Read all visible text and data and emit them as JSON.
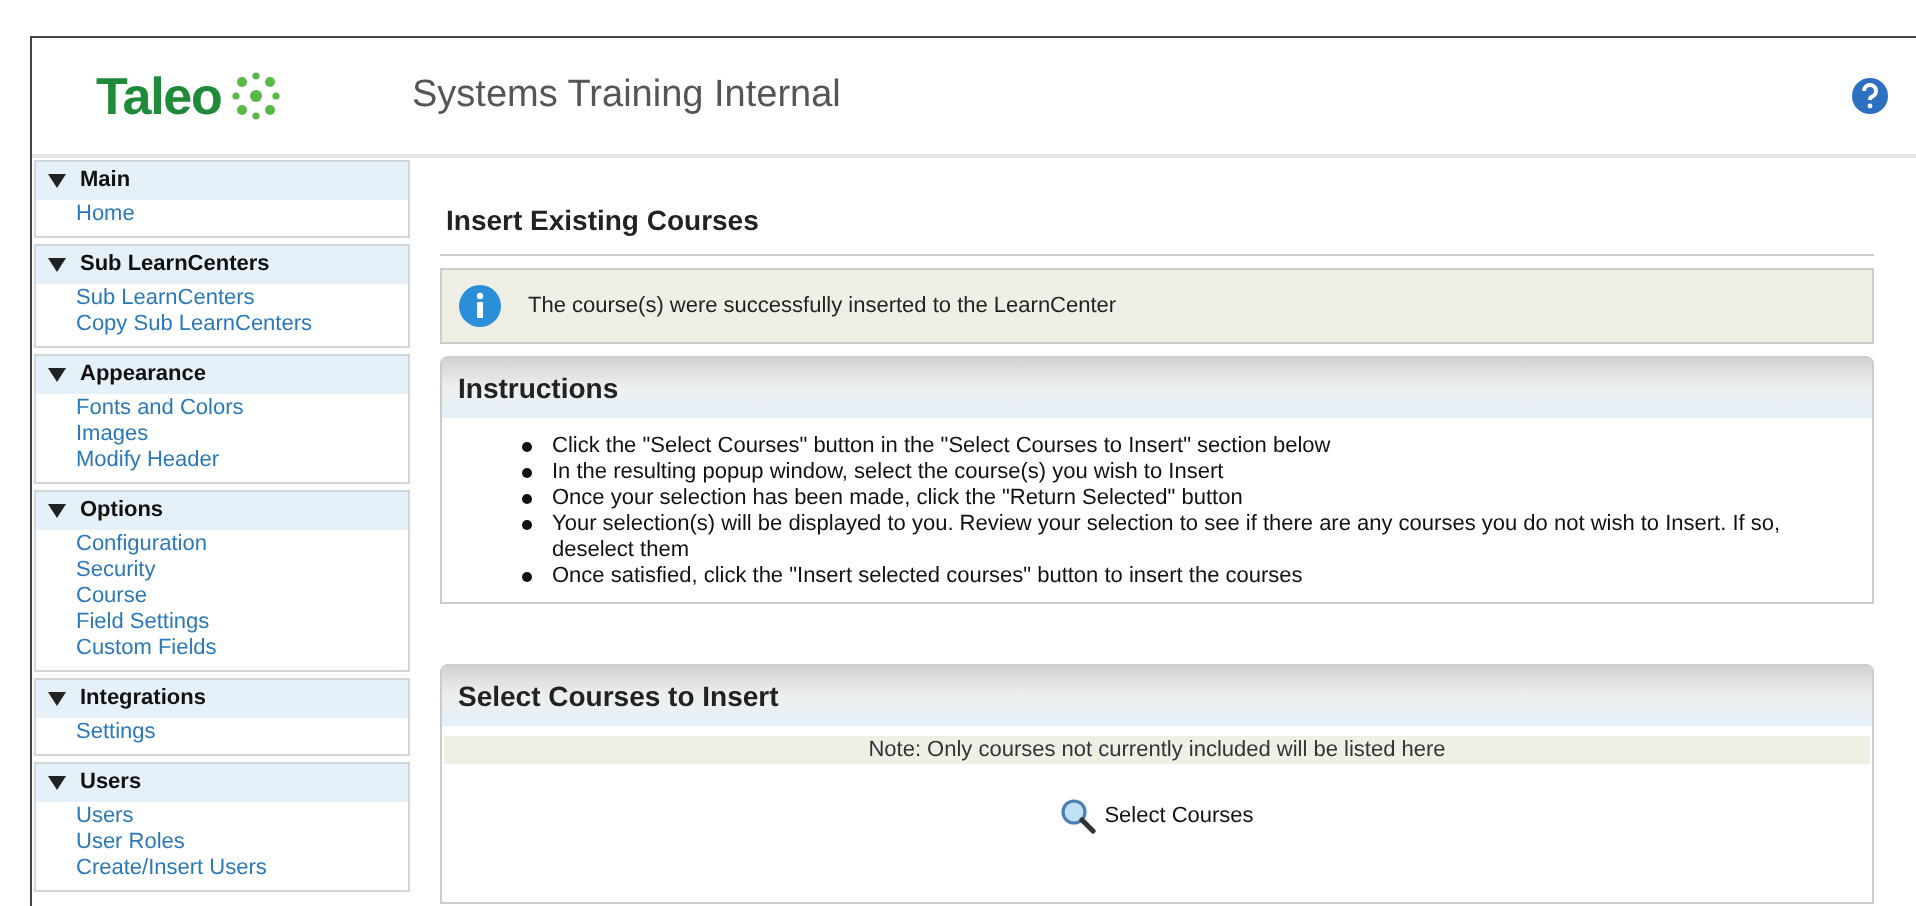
{
  "header": {
    "logo": "Taleo",
    "title": "Systems Training Internal"
  },
  "sidebar": [
    {
      "title": "Main",
      "expanded": true,
      "items": [
        "Home"
      ]
    },
    {
      "title": "Sub LearnCenters",
      "expanded": true,
      "items": [
        "Sub LearnCenters",
        "Copy Sub LearnCenters"
      ]
    },
    {
      "title": "Appearance",
      "expanded": true,
      "items": [
        "Fonts and Colors",
        "Images",
        "Modify Header"
      ]
    },
    {
      "title": "Options",
      "expanded": true,
      "items": [
        "Configuration",
        "Security",
        "Course",
        "Field Settings",
        "Custom Fields"
      ]
    },
    {
      "title": "Integrations",
      "expanded": true,
      "items": [
        "Settings"
      ]
    },
    {
      "title": "Users",
      "expanded": true,
      "items": [
        "Users",
        "User Roles",
        "Create/Insert Users"
      ]
    }
  ],
  "page_title": "Insert Existing Courses",
  "message": "The course(s) were successfully inserted to the LearnCenter",
  "instructions": {
    "title": "Instructions",
    "items": [
      "Click the \"Select Courses\" button in the \"Select Courses to Insert\" section below",
      "In the resulting popup window, select the course(s) you wish to Insert",
      "Once your selection has been made, click the \"Return Selected\" button",
      "Your selection(s) will be displayed to you. Review your selection to see if there are any courses you do not wish to Insert. If so, deselect them",
      "Once satisfied, click the \"Insert selected courses\" button to insert the courses"
    ]
  },
  "select_section": {
    "title": "Select Courses to Insert",
    "note": "Note: Only courses not currently included will be listed here",
    "button": "Select Courses"
  }
}
